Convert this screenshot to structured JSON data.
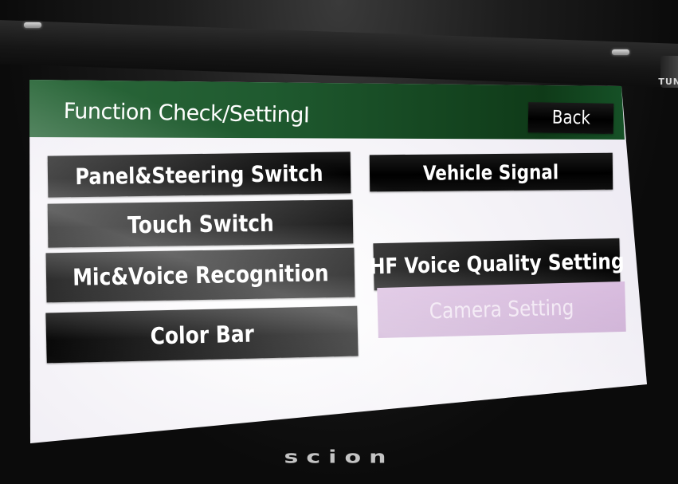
{
  "screen": {
    "title": "Function Check/SettingⅠ",
    "back_label": "Back"
  },
  "menu": {
    "left": [
      {
        "label": "Panel&Steering Switch",
        "enabled": true
      },
      {
        "label": "Touch Switch",
        "enabled": true
      },
      {
        "label": "Mic&Voice Recognition",
        "enabled": true
      },
      {
        "label": "Color Bar",
        "enabled": true
      }
    ],
    "right": [
      {
        "label": "Vehicle Signal",
        "enabled": true
      },
      {
        "label": "HF Voice Quality Setting",
        "enabled": true
      },
      {
        "label": "Camera Setting",
        "enabled": false
      }
    ]
  },
  "device": {
    "brand": "scion",
    "knob_label": "TUN"
  },
  "colors": {
    "header_green": "#1f5a2f",
    "button_black": "#000000",
    "disabled_lavender": "#caaad2",
    "screen_background": "#f4f2f7"
  }
}
